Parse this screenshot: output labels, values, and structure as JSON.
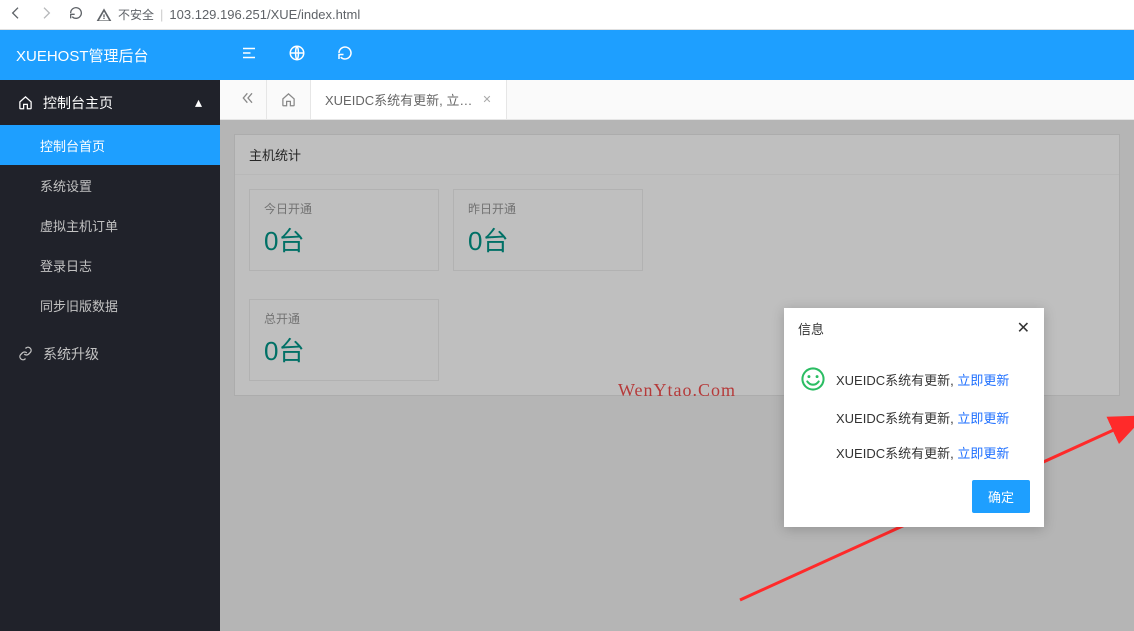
{
  "browser": {
    "insecure_label": "不安全",
    "url": "103.129.196.251/XUE/index.html"
  },
  "brand": "XUEHOST管理后台",
  "sidebar": {
    "section_title": "控制台主页",
    "items": [
      {
        "label": "控制台首页",
        "active": true
      },
      {
        "label": "系统设置",
        "active": false
      },
      {
        "label": "虚拟主机订单",
        "active": false
      },
      {
        "label": "登录日志",
        "active": false
      },
      {
        "label": "同步旧版数据",
        "active": false
      }
    ],
    "upgrade_label": "系统升级"
  },
  "tabs": {
    "active_tab": "XUEIDC系统有更新, 立…"
  },
  "panel": {
    "title": "主机统计",
    "stats": [
      {
        "label": "今日开通",
        "value": "0台"
      },
      {
        "label": "昨日开通",
        "value": "0台"
      },
      {
        "label": "总开通",
        "value": "0台"
      }
    ]
  },
  "watermark": "WenYtao.Com",
  "modal": {
    "title": "信息",
    "rows": [
      {
        "text": "XUEIDC系统有更新, ",
        "link": "立即更新"
      },
      {
        "text": "XUEIDC系统有更新, ",
        "link": "立即更新"
      },
      {
        "text": "XUEIDC系统有更新, ",
        "link": "立即更新"
      }
    ],
    "ok": "确定"
  }
}
